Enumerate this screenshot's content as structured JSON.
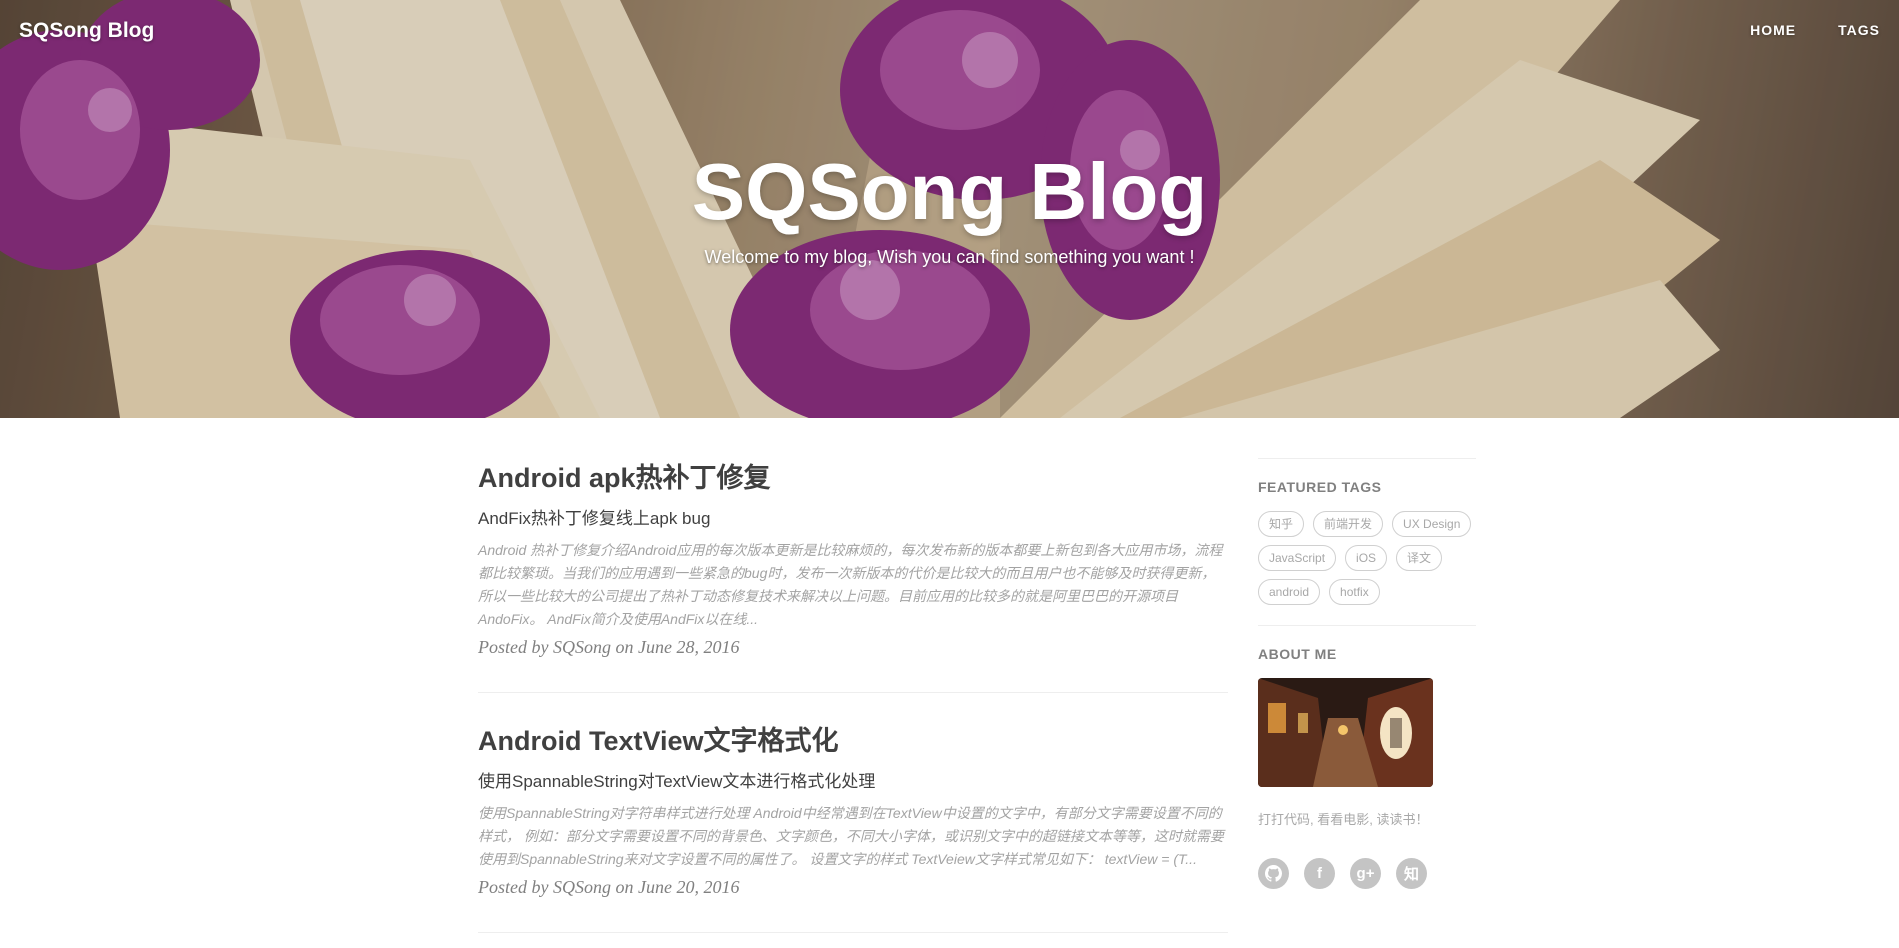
{
  "header": {
    "brand": "SQSong Blog",
    "nav": [
      {
        "label": "HOME"
      },
      {
        "label": "TAGS"
      }
    ]
  },
  "hero": {
    "title": "SQSong Blog",
    "subtitle": "Welcome to my blog, Wish you can find something you want !"
  },
  "posts": [
    {
      "title": "Android apk热补丁修复",
      "subtitle": "AndFix热补丁修复线上apk bug",
      "excerpt": "Android 热补丁修复介绍Android应用的每次版本更新是比较麻烦的，每次发布新的版本都要上新包到各大应用市场，流程都比较繁琐。当我们的应用遇到一些紧急的bug时，发布一次新版本的代价是比较大的而且用户也不能够及时获得更新，所以一些比较大的公司提出了热补丁动态修复技术来解决以上问题。目前应用的比较多的就是阿里巴巴的开源项目AndoFix。 AndFix简介及使用AndFix以在线...",
      "meta": "Posted by SQSong on June 28, 2016"
    },
    {
      "title": "Android TextView文字格式化",
      "subtitle": "使用SpannableString对TextView文本进行格式化处理",
      "excerpt": "使用SpannableString对字符串样式进行处理 Android中经常遇到在TextView中设置的文字中，有部分文字需要设置不同的样式， 例如：部分文字需要设置不同的背景色、文字颜色，不同大小字体，或识别文字中的超链接文本等等，这时就需要使用到SpannableString来对文字设置不同的属性了。 设置文字的样式 TextVeiew文字样式常见如下： textView = (T...",
      "meta": "Posted by SQSong on June 20, 2016"
    }
  ],
  "sidebar": {
    "featured_tags_heading": "FEATURED TAGS",
    "tags": [
      "知乎",
      "前端开发",
      "UX Design",
      "JavaScript",
      "iOS",
      "译文",
      "android",
      "hotfix"
    ],
    "about_heading": "ABOUT ME",
    "about_text": "打打代码, 看看电影, 读读书！",
    "socials": [
      {
        "icon": "github-icon"
      },
      {
        "icon": "facebook-icon",
        "glyph": "f"
      },
      {
        "icon": "google-plus-icon",
        "glyph": "g+"
      },
      {
        "icon": "zhihu-icon",
        "glyph": "知"
      }
    ]
  },
  "colors": {
    "text": "#404040",
    "muted": "#808080",
    "excerpt": "#a3a3a3",
    "tag_border": "#d0d0d0",
    "social_bg": "#c4c4c4"
  }
}
